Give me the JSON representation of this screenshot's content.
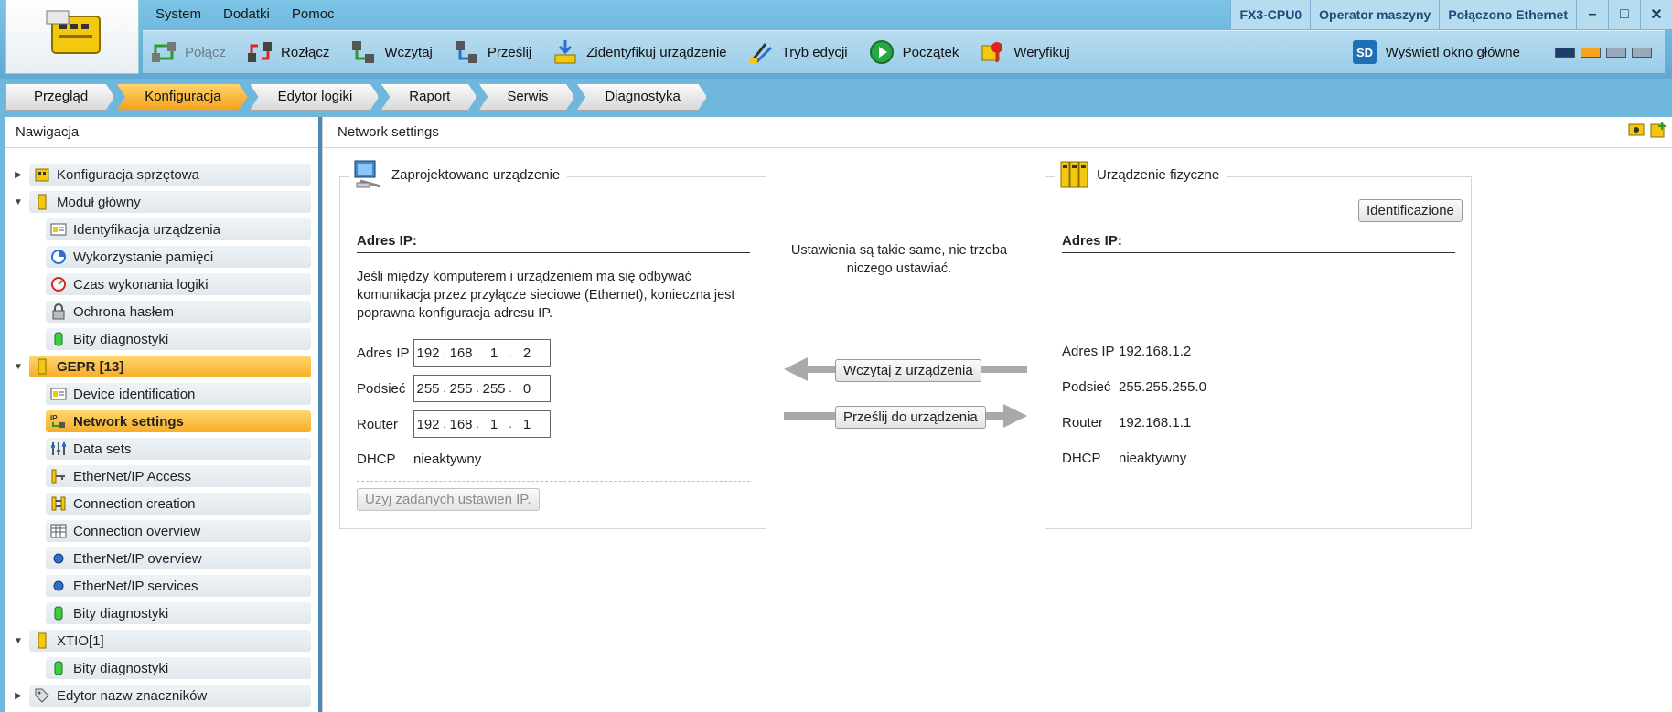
{
  "menu": [
    "System",
    "Dodatki",
    "Pomoc"
  ],
  "status": {
    "device": "FX3-CPU0",
    "user": "Operator maszyny",
    "connection": "Połączono Ethernet"
  },
  "toolbar": {
    "connect": "Połącz",
    "disconnect": "Rozłącz",
    "load": "Wczytaj",
    "send": "Prześlij",
    "identify": "Zidentyfikuj urządzenie",
    "edit_mode": "Tryb edycji",
    "start": "Początek",
    "verify": "Weryfikuj",
    "show_main": "Wyświetl okno główne"
  },
  "tabs": [
    "Przegląd",
    "Konfiguracja",
    "Edytor logiki",
    "Raport",
    "Serwis",
    "Diagnostyka"
  ],
  "navigation": {
    "title": "Nawigacja",
    "items": [
      {
        "label": "Konfiguracja sprzętowa",
        "level": 0,
        "toggle": "collapsed"
      },
      {
        "label": "Moduł główny",
        "level": 0,
        "toggle": "expanded"
      },
      {
        "label": "Identyfikacja urządzenia",
        "level": 1
      },
      {
        "label": "Wykorzystanie pamięci",
        "level": 1
      },
      {
        "label": "Czas wykonania logiki",
        "level": 1
      },
      {
        "label": "Ochrona hasłem",
        "level": 1
      },
      {
        "label": "Bity diagnostyki",
        "level": 1
      },
      {
        "label": "GEPR [13]",
        "level": 0,
        "toggle": "expanded"
      },
      {
        "label": "Device identification",
        "level": 1
      },
      {
        "label": "Network settings",
        "level": 1
      },
      {
        "label": "Data sets",
        "level": 1
      },
      {
        "label": "EtherNet/IP Access",
        "level": 1
      },
      {
        "label": "Connection creation",
        "level": 1
      },
      {
        "label": "Connection overview",
        "level": 1
      },
      {
        "label": "EtherNet/IP overview",
        "level": 1
      },
      {
        "label": "EtherNet/IP services",
        "level": 1
      },
      {
        "label": "Bity diagnostyki",
        "level": 1
      },
      {
        "label": "XTIO[1]",
        "level": 0,
        "toggle": "expanded"
      },
      {
        "label": "Bity diagnostyki",
        "level": 1
      },
      {
        "label": "Edytor nazw znaczników",
        "level": 0,
        "toggle": "collapsed"
      }
    ]
  },
  "content": {
    "title": "Network settings",
    "designed": {
      "title": "Zaprojektowane urządzenie",
      "section": "Adres IP:",
      "description": "Jeśli między komputerem i urządzeniem ma się odbywać komunikacja przez przyłącze sieciowe (Ethernet), konieczna jest poprawna konfiguracja adresu IP.",
      "ip_label": "Adres IP",
      "ip": [
        "192",
        "168",
        "1",
        "2"
      ],
      "subnet_label": "Podsieć",
      "subnet": [
        "255",
        "255",
        "255",
        "0"
      ],
      "router_label": "Router",
      "router": [
        "192",
        "168",
        "1",
        "1"
      ],
      "dhcp_label": "DHCP",
      "dhcp_value": "nieaktywny",
      "apply_button": "Użyj zadanych ustawień IP."
    },
    "middle": {
      "message": "Ustawienia są takie same, nie trzeba niczego ustawiać.",
      "load_button": "Wczytaj z urządzenia",
      "send_button": "Prześlij do urządzenia"
    },
    "physical": {
      "title": "Urządzenie fizyczne",
      "identify_button": "Identificazione",
      "section": "Adres IP:",
      "ip_label": "Adres IP",
      "ip_value": "192.168.1.2",
      "subnet_label": "Podsieć",
      "subnet_value": "255.255.255.0",
      "router_label": "Router",
      "router_value": "192.168.1.1",
      "dhcp_label": "DHCP",
      "dhcp_value": "nieaktywny"
    }
  }
}
